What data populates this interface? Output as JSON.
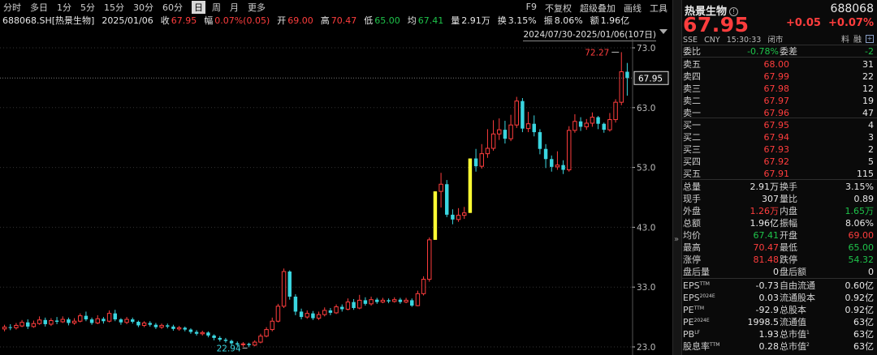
{
  "toolbar": {
    "periods": [
      "分时",
      "多日",
      "1分",
      "5分",
      "15分",
      "30分",
      "60分",
      "日",
      "周",
      "月",
      "更多"
    ],
    "active_period": "日",
    "tools": [
      "F9",
      "不复权",
      "超级叠加",
      "画线",
      "工具"
    ]
  },
  "info_bar": {
    "symbol": "688068.SH[热景生物]",
    "date": "2025/01/06",
    "close_label": "收",
    "close": "67.95",
    "change_label": "幅",
    "change": "0.07%(0.05)",
    "open_label": "开",
    "open": "69.00",
    "high_label": "高",
    "high": "70.47",
    "low_label": "低",
    "low": "65.00",
    "avg_label": "均",
    "avg": "67.41",
    "volume_label": "量",
    "volume": "2.91万",
    "turnover_label": "换",
    "turnover": "3.15%",
    "amplitude_label": "振",
    "amplitude": "8.06%",
    "amount_label": "额",
    "amount": "1.96亿"
  },
  "range_label": "2024/07/30-2025/01/06(107日)",
  "chart_data": {
    "type": "candlestick",
    "y_axis_ticks": [
      "73.0",
      "63.0",
      "53.0",
      "43.0",
      "33.0",
      "23.0"
    ],
    "ylim": [
      23,
      73
    ],
    "current_price_label": "67.95",
    "current_price": 67.95,
    "max_label": "72.27",
    "max_value": 72.27,
    "min_label": "22.94",
    "min_value": 22.94,
    "colors": {
      "up": "#ff3d3d",
      "down": "#3ad6e0",
      "limit_up": "#ffff33",
      "axis": "#bbbbbb",
      "grid": "#333333"
    },
    "candles": [
      {
        "o": 26.0,
        "c": 26.3,
        "h": 26.7,
        "l": 25.6
      },
      {
        "o": 26.3,
        "c": 26.2,
        "h": 26.8,
        "l": 25.8
      },
      {
        "o": 26.2,
        "c": 26.6,
        "h": 27.0,
        "l": 25.9
      },
      {
        "o": 26.5,
        "c": 27.1,
        "h": 27.5,
        "l": 26.3
      },
      {
        "o": 27.1,
        "c": 26.4,
        "h": 27.6,
        "l": 26.0
      },
      {
        "o": 26.4,
        "c": 26.9,
        "h": 27.4,
        "l": 26.2
      },
      {
        "o": 26.9,
        "c": 27.5,
        "h": 28.1,
        "l": 26.7
      },
      {
        "o": 27.5,
        "c": 26.8,
        "h": 27.9,
        "l": 26.4
      },
      {
        "o": 26.8,
        "c": 27.4,
        "h": 27.8,
        "l": 26.5
      },
      {
        "o": 27.4,
        "c": 27.2,
        "h": 28.0,
        "l": 26.8
      },
      {
        "o": 27.2,
        "c": 27.6,
        "h": 28.1,
        "l": 27.0
      },
      {
        "o": 27.6,
        "c": 27.0,
        "h": 27.9,
        "l": 26.6
      },
      {
        "o": 27.0,
        "c": 27.3,
        "h": 27.8,
        "l": 26.7
      },
      {
        "o": 27.3,
        "c": 28.2,
        "h": 28.6,
        "l": 27.1
      },
      {
        "o": 28.2,
        "c": 27.6,
        "h": 28.9,
        "l": 27.3
      },
      {
        "o": 27.6,
        "c": 27.0,
        "h": 27.9,
        "l": 26.7
      },
      {
        "o": 27.0,
        "c": 27.7,
        "h": 28.3,
        "l": 26.8
      },
      {
        "o": 27.7,
        "c": 27.3,
        "h": 28.0,
        "l": 26.9
      },
      {
        "o": 27.3,
        "c": 28.6,
        "h": 29.1,
        "l": 27.1
      },
      {
        "o": 28.6,
        "c": 27.6,
        "h": 29.2,
        "l": 27.3
      },
      {
        "o": 27.6,
        "c": 27.1,
        "h": 27.8,
        "l": 26.7
      },
      {
        "o": 27.1,
        "c": 27.6,
        "h": 28.0,
        "l": 26.8
      },
      {
        "o": 27.6,
        "c": 27.2,
        "h": 27.9,
        "l": 26.9
      },
      {
        "o": 27.2,
        "c": 26.6,
        "h": 27.4,
        "l": 26.3
      },
      {
        "o": 26.6,
        "c": 27.0,
        "h": 27.3,
        "l": 26.3
      },
      {
        "o": 27.0,
        "c": 26.7,
        "h": 27.3,
        "l": 26.4
      },
      {
        "o": 26.7,
        "c": 26.3,
        "h": 27.0,
        "l": 26.0
      },
      {
        "o": 26.3,
        "c": 26.6,
        "h": 26.9,
        "l": 26.0
      },
      {
        "o": 26.6,
        "c": 26.4,
        "h": 26.9,
        "l": 26.1
      },
      {
        "o": 26.4,
        "c": 26.0,
        "h": 26.7,
        "l": 25.7
      },
      {
        "o": 26.0,
        "c": 26.2,
        "h": 26.5,
        "l": 25.7
      },
      {
        "o": 26.2,
        "c": 25.9,
        "h": 26.4,
        "l": 25.6
      },
      {
        "o": 25.9,
        "c": 25.5,
        "h": 26.1,
        "l": 25.2
      },
      {
        "o": 25.5,
        "c": 25.2,
        "h": 25.8,
        "l": 24.9
      },
      {
        "o": 25.2,
        "c": 25.4,
        "h": 25.7,
        "l": 24.9
      },
      {
        "o": 25.4,
        "c": 24.9,
        "h": 25.6,
        "l": 24.6
      },
      {
        "o": 24.9,
        "c": 24.5,
        "h": 25.1,
        "l": 24.1
      },
      {
        "o": 24.5,
        "c": 24.2,
        "h": 24.8,
        "l": 23.9
      },
      {
        "o": 24.2,
        "c": 24.0,
        "h": 24.5,
        "l": 23.7
      },
      {
        "o": 24.0,
        "c": 23.6,
        "h": 24.2,
        "l": 23.3
      },
      {
        "o": 23.6,
        "c": 23.4,
        "h": 23.9,
        "l": 23.1
      },
      {
        "o": 23.4,
        "c": 23.5,
        "h": 23.8,
        "l": 23.0
      },
      {
        "o": 23.5,
        "c": 23.3,
        "h": 23.7,
        "l": 22.94
      },
      {
        "o": 23.3,
        "c": 23.8,
        "h": 24.1,
        "l": 23.1
      },
      {
        "o": 23.8,
        "c": 24.8,
        "h": 25.2,
        "l": 23.6
      },
      {
        "o": 24.8,
        "c": 25.9,
        "h": 26.3,
        "l": 24.6
      },
      {
        "o": 25.9,
        "c": 27.3,
        "h": 27.9,
        "l": 25.6
      },
      {
        "o": 27.3,
        "c": 29.8,
        "h": 30.2,
        "l": 27.1
      },
      {
        "o": 29.8,
        "c": 35.6,
        "h": 36.1,
        "l": 29.5
      },
      {
        "o": 35.6,
        "c": 31.4,
        "h": 35.8,
        "l": 30.9
      },
      {
        "o": 31.4,
        "c": 28.9,
        "h": 31.8,
        "l": 28.3
      },
      {
        "o": 28.9,
        "c": 28.0,
        "h": 29.4,
        "l": 27.6
      },
      {
        "o": 28.0,
        "c": 28.6,
        "h": 29.1,
        "l": 27.7
      },
      {
        "o": 28.6,
        "c": 27.8,
        "h": 29.0,
        "l": 27.5
      },
      {
        "o": 27.8,
        "c": 28.4,
        "h": 28.9,
        "l": 27.5
      },
      {
        "o": 28.4,
        "c": 29.1,
        "h": 29.6,
        "l": 28.1
      },
      {
        "o": 29.1,
        "c": 28.7,
        "h": 29.5,
        "l": 28.3
      },
      {
        "o": 28.7,
        "c": 29.7,
        "h": 30.1,
        "l": 28.5
      },
      {
        "o": 29.7,
        "c": 29.3,
        "h": 30.1,
        "l": 28.9
      },
      {
        "o": 29.3,
        "c": 30.5,
        "h": 31.1,
        "l": 29.1
      },
      {
        "o": 30.5,
        "c": 29.5,
        "h": 31.0,
        "l": 29.2
      },
      {
        "o": 29.5,
        "c": 30.8,
        "h": 31.7,
        "l": 29.3
      },
      {
        "o": 30.8,
        "c": 30.2,
        "h": 31.3,
        "l": 29.9
      },
      {
        "o": 30.2,
        "c": 30.9,
        "h": 31.4,
        "l": 29.9
      },
      {
        "o": 30.9,
        "c": 30.5,
        "h": 31.2,
        "l": 30.2
      },
      {
        "o": 30.5,
        "c": 30.8,
        "h": 31.2,
        "l": 30.3
      },
      {
        "o": 30.8,
        "c": 30.6,
        "h": 31.1,
        "l": 30.3
      },
      {
        "o": 30.6,
        "c": 30.9,
        "h": 31.3,
        "l": 30.4
      },
      {
        "o": 30.9,
        "c": 30.5,
        "h": 31.2,
        "l": 30.2
      },
      {
        "o": 30.5,
        "c": 30.8,
        "h": 31.2,
        "l": 30.3
      },
      {
        "o": 30.8,
        "c": 29.9,
        "h": 31.1,
        "l": 29.7
      },
      {
        "o": 29.9,
        "c": 31.9,
        "h": 32.4,
        "l": 29.8
      },
      {
        "o": 31.9,
        "c": 34.3,
        "h": 34.8,
        "l": 31.6
      },
      {
        "o": 34.3,
        "c": 40.9,
        "h": 41.3,
        "l": 33.9
      },
      {
        "o": 40.9,
        "c": 49.0,
        "h": 49.0,
        "l": 40.9,
        "limit": true
      },
      {
        "o": 49.0,
        "c": 50.2,
        "h": 52.1,
        "l": 46.3
      },
      {
        "o": 50.2,
        "c": 45.1,
        "h": 50.9,
        "l": 44.7
      },
      {
        "o": 45.1,
        "c": 44.3,
        "h": 46.0,
        "l": 43.5
      },
      {
        "o": 44.3,
        "c": 45.0,
        "h": 46.2,
        "l": 43.9
      },
      {
        "o": 45.0,
        "c": 45.4,
        "h": 46.4,
        "l": 44.4
      },
      {
        "o": 45.4,
        "c": 54.5,
        "h": 54.5,
        "l": 45.4,
        "limit": true
      },
      {
        "o": 54.5,
        "c": 53.2,
        "h": 56.1,
        "l": 52.3
      },
      {
        "o": 53.2,
        "c": 55.3,
        "h": 56.9,
        "l": 52.8
      },
      {
        "o": 55.3,
        "c": 56.2,
        "h": 59.4,
        "l": 54.6
      },
      {
        "o": 56.2,
        "c": 58.6,
        "h": 60.9,
        "l": 55.8
      },
      {
        "o": 58.6,
        "c": 59.3,
        "h": 61.2,
        "l": 57.6
      },
      {
        "o": 59.3,
        "c": 57.8,
        "h": 60.8,
        "l": 57.0
      },
      {
        "o": 57.8,
        "c": 60.1,
        "h": 61.8,
        "l": 57.4
      },
      {
        "o": 60.1,
        "c": 64.1,
        "h": 64.8,
        "l": 59.6
      },
      {
        "o": 64.1,
        "c": 59.5,
        "h": 64.6,
        "l": 58.9
      },
      {
        "o": 59.5,
        "c": 60.3,
        "h": 62.3,
        "l": 58.9
      },
      {
        "o": 60.3,
        "c": 58.9,
        "h": 61.7,
        "l": 58.2
      },
      {
        "o": 58.9,
        "c": 56.1,
        "h": 59.4,
        "l": 55.2
      },
      {
        "o": 56.1,
        "c": 54.4,
        "h": 56.9,
        "l": 52.9
      },
      {
        "o": 54.4,
        "c": 53.1,
        "h": 55.0,
        "l": 52.3
      },
      {
        "o": 53.1,
        "c": 53.4,
        "h": 55.7,
        "l": 52.6
      },
      {
        "o": 53.4,
        "c": 52.6,
        "h": 54.2,
        "l": 51.9
      },
      {
        "o": 52.6,
        "c": 59.2,
        "h": 59.9,
        "l": 52.3
      },
      {
        "o": 59.2,
        "c": 60.7,
        "h": 61.9,
        "l": 58.8
      },
      {
        "o": 60.7,
        "c": 59.8,
        "h": 61.4,
        "l": 59.1
      },
      {
        "o": 59.8,
        "c": 60.4,
        "h": 61.1,
        "l": 59.3
      },
      {
        "o": 60.4,
        "c": 61.4,
        "h": 62.2,
        "l": 59.8
      },
      {
        "o": 61.4,
        "c": 60.3,
        "h": 61.6,
        "l": 59.4
      },
      {
        "o": 60.3,
        "c": 59.3,
        "h": 60.5,
        "l": 58.8
      },
      {
        "o": 59.3,
        "c": 61.0,
        "h": 62.1,
        "l": 59.0
      },
      {
        "o": 61.0,
        "c": 63.9,
        "h": 64.4,
        "l": 60.5
      },
      {
        "o": 63.9,
        "c": 69.0,
        "h": 72.27,
        "l": 63.4
      },
      {
        "o": 69.0,
        "c": 67.95,
        "h": 70.47,
        "l": 65.0
      }
    ]
  },
  "quote": {
    "name": "热景生物",
    "code": "688068",
    "price": "67.95",
    "change": "+0.05",
    "change_pct": "+0.07%",
    "exchange": "SSE",
    "currency": "CNY",
    "time": "15:30:33",
    "status": "闭市",
    "icon_labels": [
      "料",
      "融"
    ],
    "weibi_label": "委比",
    "weibi": "-0.78%",
    "weicha_label": "委差",
    "weicha": "-2",
    "asks": [
      {
        "label": "卖五",
        "price": "68.00",
        "vol": "31"
      },
      {
        "label": "卖四",
        "price": "67.99",
        "vol": "22"
      },
      {
        "label": "卖三",
        "price": "67.98",
        "vol": "12"
      },
      {
        "label": "卖二",
        "price": "67.97",
        "vol": "19"
      },
      {
        "label": "卖一",
        "price": "67.96",
        "vol": "47"
      }
    ],
    "bids": [
      {
        "label": "买一",
        "price": "67.95",
        "vol": "4"
      },
      {
        "label": "买二",
        "price": "67.94",
        "vol": "3"
      },
      {
        "label": "买三",
        "price": "67.93",
        "vol": "2"
      },
      {
        "label": "买四",
        "price": "67.92",
        "vol": "5"
      },
      {
        "label": "买五",
        "price": "67.91",
        "vol": "115"
      }
    ],
    "stats": [
      [
        {
          "l": "总量",
          "v": "2.91万",
          "c": "white"
        },
        {
          "l": "换手",
          "v": "3.15%",
          "c": "white"
        }
      ],
      [
        {
          "l": "现手",
          "v": "307",
          "c": "white"
        },
        {
          "l": "量比",
          "v": "0.89",
          "c": "white"
        }
      ],
      [
        {
          "l": "外盘",
          "v": "1.26万",
          "c": "red"
        },
        {
          "l": "内盘",
          "v": "1.65万",
          "c": "green"
        }
      ],
      [
        {
          "l": "总额",
          "v": "1.96亿",
          "c": "white"
        },
        {
          "l": "振幅",
          "v": "8.06%",
          "c": "white"
        }
      ],
      [
        {
          "l": "均价",
          "v": "67.41",
          "c": "green"
        },
        {
          "l": "开盘",
          "v": "69.00",
          "c": "red"
        }
      ],
      [
        {
          "l": "最高",
          "v": "70.47",
          "c": "red"
        },
        {
          "l": "最低",
          "v": "65.00",
          "c": "green"
        }
      ],
      [
        {
          "l": "涨停",
          "v": "81.48",
          "c": "red"
        },
        {
          "l": "跌停",
          "v": "54.32",
          "c": "green"
        }
      ],
      [
        {
          "l": "盘后量",
          "v": "0",
          "c": "white"
        },
        {
          "l": "盘后额",
          "v": "0",
          "c": "white"
        }
      ]
    ],
    "fundamentals": [
      [
        {
          "l": "EPS",
          "sup": "TTM",
          "v": "-0.73"
        },
        {
          "l": "自由流通",
          "sup": "",
          "v": "0.60亿"
        }
      ],
      [
        {
          "l": "EPS",
          "sup": "2024E",
          "v": "0.03"
        },
        {
          "l": "流通股本",
          "sup": "",
          "v": "0.92亿"
        }
      ],
      [
        {
          "l": "PE",
          "sup": "TTM",
          "v": "-92.9"
        },
        {
          "l": "总股本",
          "sup": "",
          "v": "0.92亿"
        }
      ],
      [
        {
          "l": "PE",
          "sup": "2024E",
          "v": "1998.5"
        },
        {
          "l": "流通值",
          "sup": "",
          "v": "63亿"
        }
      ],
      [
        {
          "l": "PB",
          "sup": "LF",
          "v": "1.93"
        },
        {
          "l": "总市值",
          "sup": "1",
          "v": "63亿"
        }
      ],
      [
        {
          "l": "股息率",
          "sup": "TTM",
          "v": "0.28"
        },
        {
          "l": "总市值",
          "sup": "2",
          "v": "63亿"
        }
      ]
    ]
  }
}
